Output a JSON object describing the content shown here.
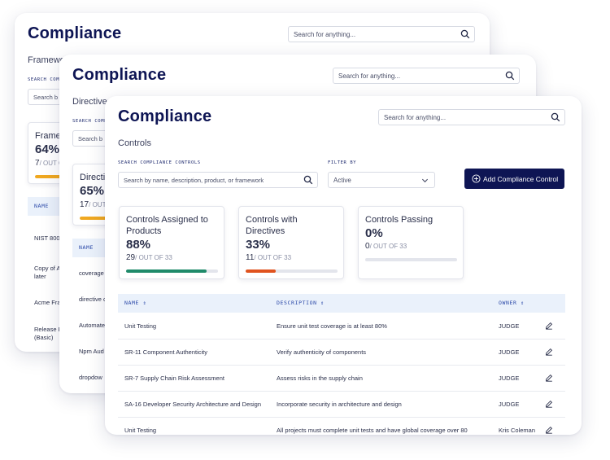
{
  "app_title": "Compliance",
  "search": {
    "placeholder": "Search for anything..."
  },
  "back_card_1": {
    "section": "Frameworks",
    "search_label": "SEARCH COMPLIANCE",
    "search_placeholder": "Search b",
    "stat": {
      "title": "Framew",
      "percent": "64%",
      "count": "7",
      "of_text": "/ OUT OF"
    },
    "col_name": "NAME",
    "rows": [
      "NIST 800",
      "Copy of A",
      "later",
      "Acme Fra",
      "Release P",
      "(Basic)"
    ]
  },
  "back_card_2": {
    "section": "Directives",
    "search_label": "SEARCH COMPLIANCE",
    "search_placeholder": "Search b",
    "stat": {
      "title": "Directi",
      "percent": "65%",
      "count": "17",
      "of_text": "/ OUT"
    },
    "col_name": "NAME",
    "rows": [
      "coverage",
      "directive c",
      "Automate",
      "Npm Aud",
      "dropdow"
    ]
  },
  "front_card": {
    "section": "Controls",
    "search_controls_label": "SEARCH COMPLIANCE CONTROLS",
    "search_controls_placeholder": "Search by name, description, product, or framework",
    "filter_label": "FILTER BY",
    "filter_value": "Active",
    "add_button": "Add Compliance Control",
    "stats": [
      {
        "title1": "Controls Assigned to",
        "title2": "Products",
        "percent": "88%",
        "count": "29",
        "of_text": "/ OUT OF 33",
        "fill": 0.88,
        "color": "#1f8a6a"
      },
      {
        "title1": "Controls with",
        "title2": "Directives",
        "percent": "33%",
        "count": "11",
        "of_text": "/ OUT OF 33",
        "fill": 0.33,
        "color": "#e0531f"
      },
      {
        "title1": "Controls Passing",
        "title2": "",
        "percent": "0%",
        "count": "0",
        "of_text": "/ OUT OF 33",
        "fill": 0,
        "color": "#1f8a6a"
      }
    ],
    "columns": {
      "name": "NAME",
      "description": "DESCRIPTION",
      "owner": "OWNER"
    },
    "rows": [
      {
        "name": "Unit Testing",
        "description": "Ensure unit test coverage is at least 80%",
        "owner": "JUDGE"
      },
      {
        "name": "SR-11 Component Authenticity",
        "description": "Verify authenticity of components",
        "owner": "JUDGE"
      },
      {
        "name": "SR-7 Supply Chain Risk Assessment",
        "description": "Assess risks in the supply chain",
        "owner": "JUDGE"
      },
      {
        "name": "SA-16 Developer Security Architecture and Design",
        "description": "Incorporate security in architecture and design",
        "owner": "JUDGE"
      },
      {
        "name": "Unit Testing",
        "description": "All projects must complete unit tests and have global coverage over 80",
        "owner": "Kris Coleman"
      }
    ]
  }
}
